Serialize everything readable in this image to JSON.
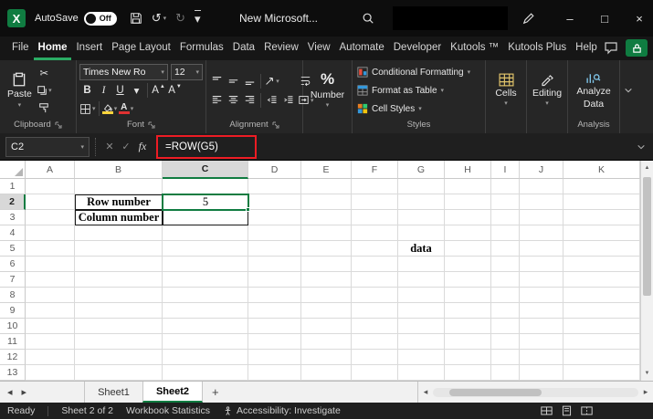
{
  "titlebar": {
    "autosave": {
      "label": "AutoSave",
      "state": "Off"
    },
    "document_title": "New Microsoft...",
    "window_buttons": {
      "minimize": "–",
      "maximize": "□",
      "close": "×"
    }
  },
  "menubar": {
    "tabs": [
      "File",
      "Home",
      "Insert",
      "Page Layout",
      "Formulas",
      "Data",
      "Review",
      "View",
      "Automate",
      "Developer",
      "Kutools ™",
      "Kutools Plus",
      "Help"
    ],
    "active_tab": "Home"
  },
  "ribbon": {
    "clipboard": {
      "group_label": "Clipboard",
      "paste_label": "Paste"
    },
    "font": {
      "group_label": "Font",
      "font_name": "Times New Ro",
      "font_size": "12",
      "bold": "B",
      "italic": "I",
      "underline": "U"
    },
    "alignment": {
      "group_label": "Alignment"
    },
    "number": {
      "percent": "%",
      "button_label": "Number"
    },
    "styles": {
      "group_label": "Styles",
      "conditional_formatting": "Conditional Formatting",
      "format_as_table": "Format as Table",
      "cell_styles": "Cell Styles"
    },
    "cells": {
      "button_label": "Cells"
    },
    "editing": {
      "button_label": "Editing"
    },
    "analysis": {
      "group_label": "Analysis",
      "analyze_line1": "Analyze",
      "analyze_line2": "Data"
    }
  },
  "formula_bar": {
    "name_box": "C2",
    "fx": "fx",
    "formula": "=ROW(G5)"
  },
  "grid": {
    "column_letters": [
      "A",
      "B",
      "C",
      "D",
      "E",
      "F",
      "G",
      "H",
      "I",
      "J",
      "K"
    ],
    "row_count": 13,
    "cells": {
      "B2": "Row number",
      "B3": "Column number",
      "C2": "5",
      "G5": "data"
    },
    "bold_cells": [
      "B2",
      "B3",
      "G5"
    ],
    "bordered_cells": [
      "B2",
      "B3",
      "C2",
      "C3"
    ],
    "selected_cell": "C2",
    "selected_col": "C",
    "selected_row": 2
  },
  "sheet_tabs": {
    "tabs": [
      {
        "name": "Sheet1",
        "active": false
      },
      {
        "name": "Sheet2",
        "active": true
      }
    ],
    "add_label": "+"
  },
  "status_bar": {
    "mode": "Ready",
    "sheet_info": "Sheet 2 of 2",
    "workbook_statistics": "Workbook Statistics",
    "accessibility": "Accessibility: Investigate"
  }
}
